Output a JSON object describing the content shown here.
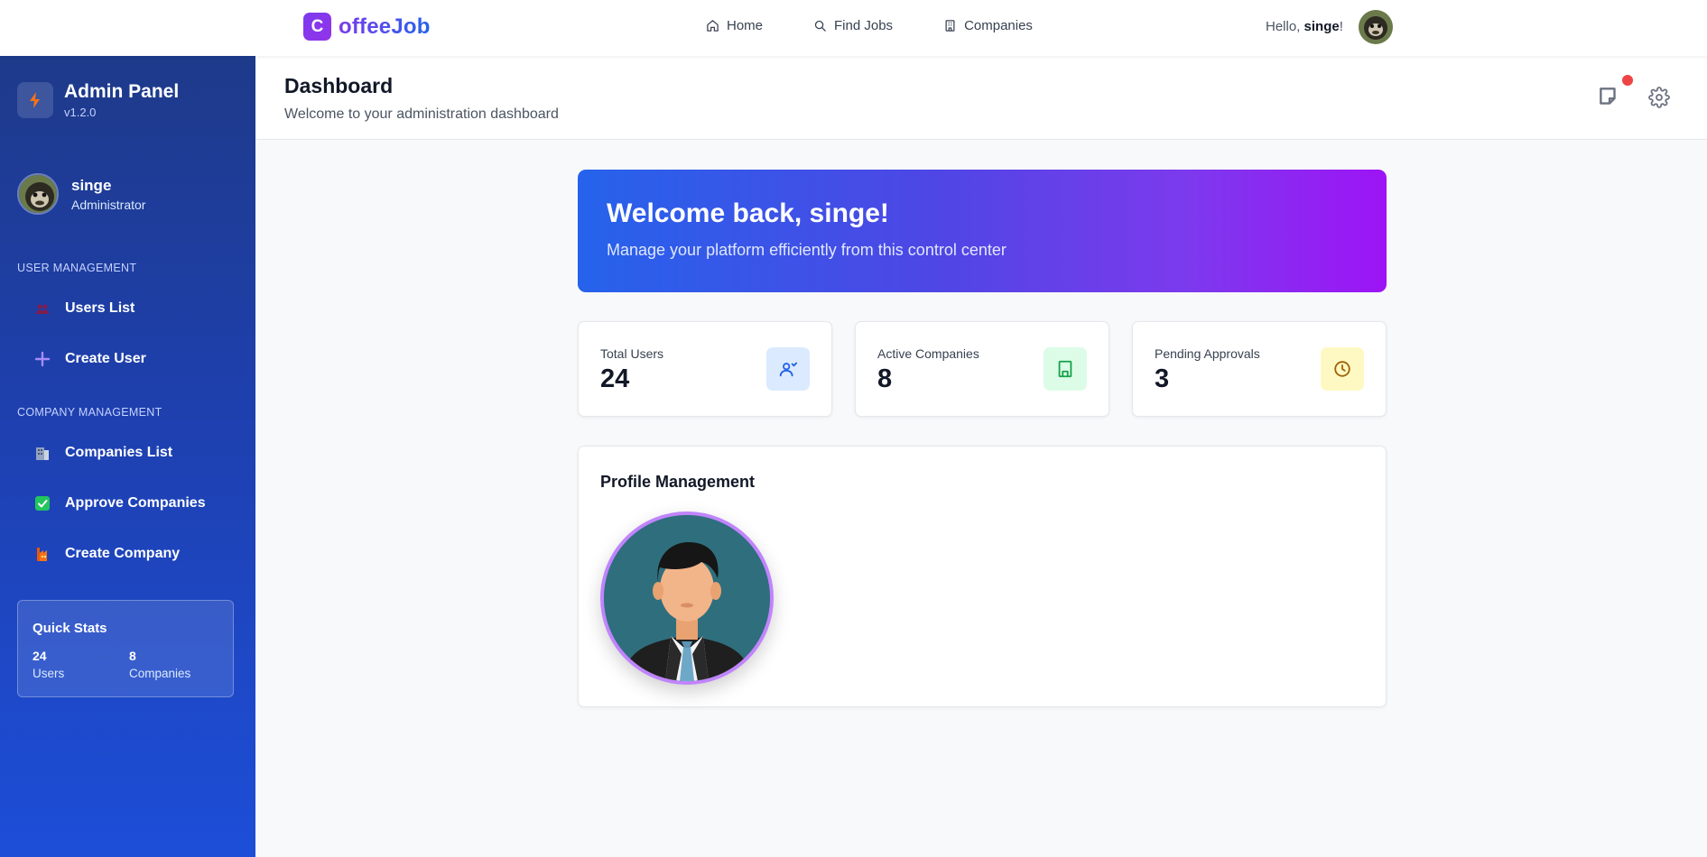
{
  "topbar": {
    "logo_letter": "C",
    "brand": "offeeJob",
    "nav": [
      {
        "label": "Home",
        "icon": "home-icon"
      },
      {
        "label": "Find Jobs",
        "icon": "search-icon"
      },
      {
        "label": "Companies",
        "icon": "building-icon"
      }
    ],
    "greeting_prefix": "Hello, ",
    "greeting_user": "singe",
    "greeting_suffix": "!"
  },
  "sidebar": {
    "title": "Admin Panel",
    "version": "v1.2.0",
    "user_name": "singe",
    "user_role": "Administrator",
    "sections": [
      {
        "title": "USER MANAGEMENT",
        "items": [
          {
            "label": "Users List",
            "icon": "people-icon"
          },
          {
            "label": "Create User",
            "icon": "plus-icon"
          }
        ]
      },
      {
        "title": "COMPANY MANAGEMENT",
        "items": [
          {
            "label": "Companies List",
            "icon": "office-building-icon"
          },
          {
            "label": "Approve Companies",
            "icon": "check-box-icon"
          },
          {
            "label": "Create Company",
            "icon": "factory-icon"
          }
        ]
      }
    ],
    "quick_stats": {
      "title": "Quick Stats",
      "users_value": "24",
      "users_label": "Users",
      "companies_value": "8",
      "companies_label": "Companies"
    }
  },
  "header": {
    "title": "Dashboard",
    "subtitle": "Welcome to your administration dashboard"
  },
  "banner": {
    "title": "Welcome back, singe!",
    "subtitle": "Manage your platform efficiently from this control center"
  },
  "stats": [
    {
      "label": "Total Users",
      "value": "24",
      "icon": "users-icon",
      "color": "#2563eb",
      "bg": "#dbeafe"
    },
    {
      "label": "Active Companies",
      "value": "8",
      "icon": "building-icon",
      "color": "#16a34a",
      "bg": "#dcfce7"
    },
    {
      "label": "Pending Approvals",
      "value": "3",
      "icon": "clock-icon",
      "color": "#a16207",
      "bg": "#fef9c3"
    }
  ],
  "profile": {
    "title": "Profile Management"
  },
  "colors": {
    "accent": "#7c3aed",
    "sidebar": "#1e40af",
    "notification": "#ef4444"
  }
}
